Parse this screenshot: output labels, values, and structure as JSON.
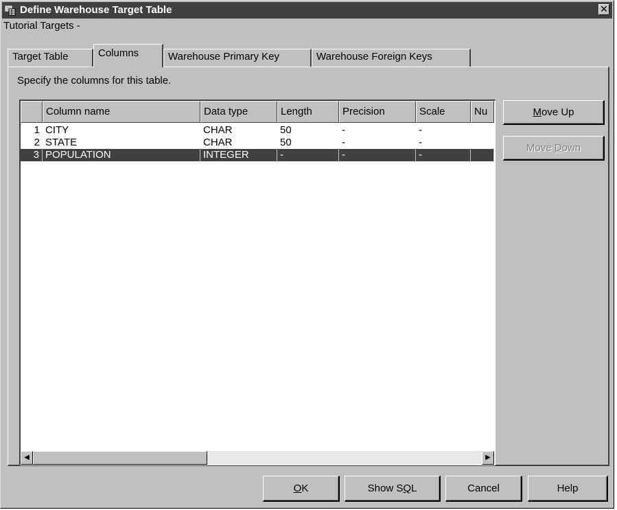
{
  "window": {
    "title": "Define Warehouse Target Table",
    "subtitle": "Tutorial Targets -",
    "close_glyph": "✕",
    "icon": "warehouse-table-icon"
  },
  "tabs": [
    {
      "label": "Target Table",
      "active": false
    },
    {
      "label": "Columns",
      "active": true
    },
    {
      "label": "Warehouse Primary Key",
      "active": false
    },
    {
      "label": "Warehouse Foreign Keys",
      "active": false
    }
  ],
  "panel": {
    "instructions": "Specify the columns for this table."
  },
  "table": {
    "columns": [
      "",
      "Column name",
      "Data type",
      "Length",
      "Precision",
      "Scale",
      "Nu"
    ],
    "rows": [
      {
        "num": "1",
        "name": "CITY",
        "type": "CHAR",
        "length": "50",
        "precision": "-",
        "scale": "-",
        "nu": ""
      },
      {
        "num": "2",
        "name": "STATE",
        "type": "CHAR",
        "length": "50",
        "precision": "-",
        "scale": "-",
        "nu": ""
      },
      {
        "num": "3",
        "name": "POPULATION",
        "type": "INTEGER",
        "length": "-",
        "precision": "-",
        "scale": "-",
        "nu": "",
        "selected": true
      }
    ],
    "scroll_left_glyph": "◀",
    "scroll_right_glyph": "▶"
  },
  "side_buttons": {
    "move_up": {
      "pre": "",
      "mnemonic": "M",
      "post": "ove Up",
      "enabled": true
    },
    "move_down": {
      "pre": "Move ",
      "mnemonic": "D",
      "post": "own",
      "enabled": false
    }
  },
  "bottom_buttons": {
    "ok": {
      "pre": "",
      "mnemonic": "O",
      "post": "K"
    },
    "show_sql": {
      "pre": "Show S",
      "mnemonic": "Q",
      "post": "L"
    },
    "cancel": {
      "label": "Cancel"
    },
    "help": {
      "label": "Help"
    }
  },
  "colors": {
    "titlebar": "#404040",
    "face": "#c0c0c0",
    "selection": "#404040"
  }
}
